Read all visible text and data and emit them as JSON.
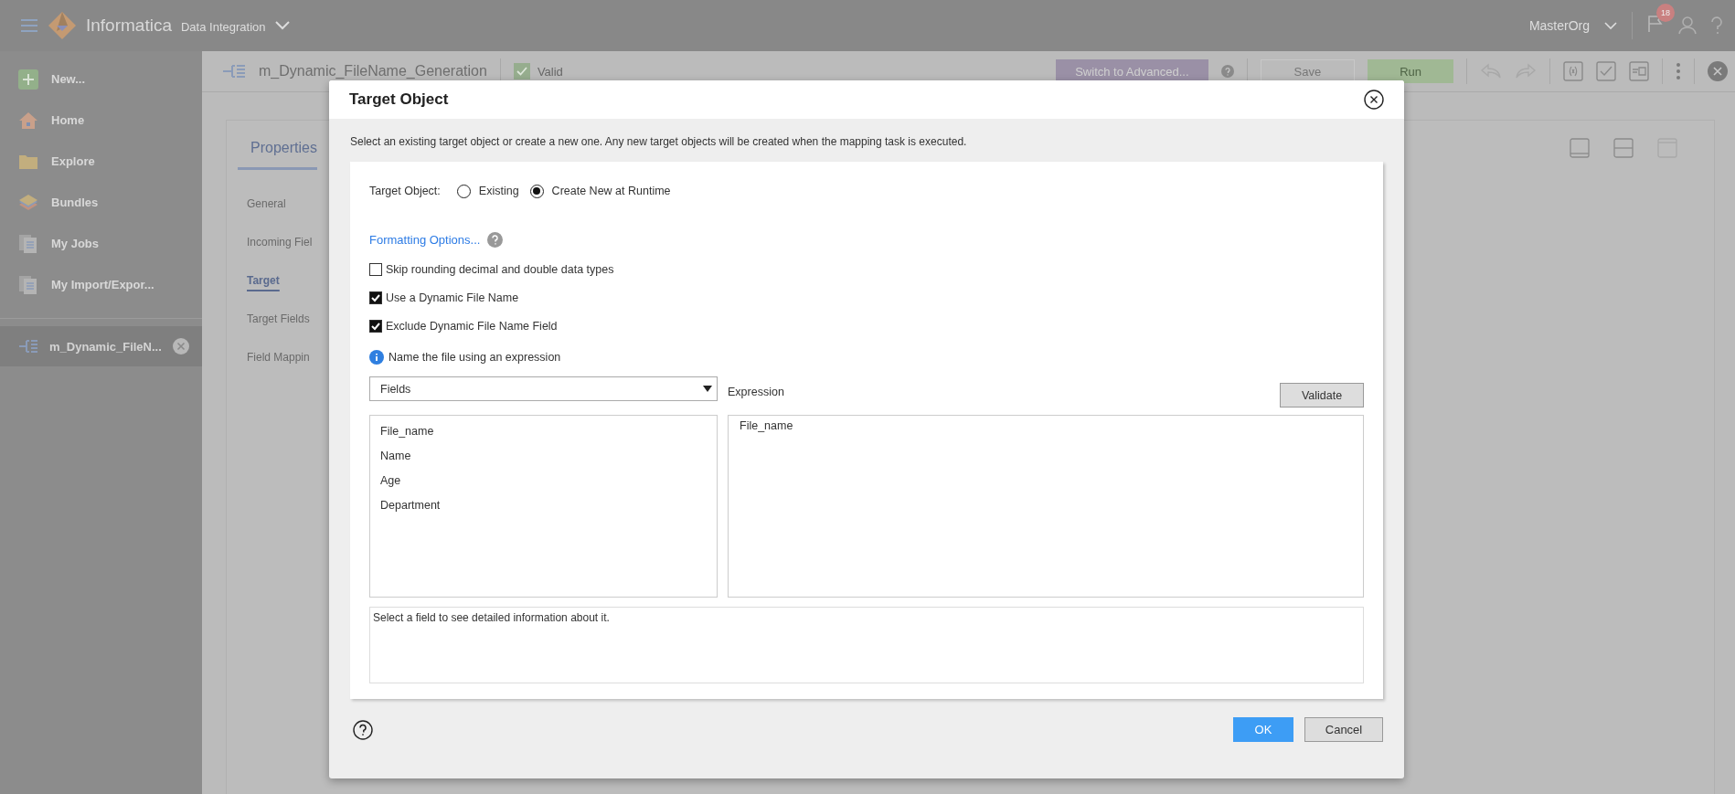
{
  "top_bar": {
    "product": "Informatica",
    "subtitle": "Data Integration",
    "org": "MasterOrg",
    "notification_count": "18"
  },
  "sidebar": {
    "items": [
      {
        "label": "New...",
        "kind": "new"
      },
      {
        "label": "Home",
        "kind": "home"
      },
      {
        "label": "Explore",
        "kind": "explore"
      },
      {
        "label": "Bundles",
        "kind": "bundles"
      },
      {
        "label": "My Jobs",
        "kind": "jobs"
      },
      {
        "label": "My Import/Expor...",
        "kind": "jobs"
      }
    ],
    "open_tabs": [
      {
        "label": "m_Dynamic_FileN...",
        "selected": true
      }
    ]
  },
  "toolbar": {
    "mapping_name": "m_Dynamic_FileName_Generation",
    "status": "Valid",
    "buttons": [
      {
        "label": "Switch to Advanced...",
        "kind": "advanced"
      },
      {
        "label": "Save",
        "kind": "save"
      },
      {
        "label": "Run",
        "kind": "run"
      }
    ]
  },
  "properties_panel": {
    "tab": "Properties",
    "nav": [
      {
        "label": "General",
        "selected": false
      },
      {
        "label": "Incoming Fiel",
        "selected": false
      },
      {
        "label": "Target",
        "selected": true
      },
      {
        "label": "Target Fields",
        "selected": false
      },
      {
        "label": "Field Mappin",
        "selected": false
      }
    ]
  },
  "dialog": {
    "title": "Target Object",
    "description": "Select an existing target object or create a new one. Any new target objects will be created when the mapping task is executed.",
    "target_object": {
      "label": "Target Object:",
      "options": [
        {
          "label": "Existing",
          "selected": false
        },
        {
          "label": "Create New at Runtime",
          "selected": true
        }
      ]
    },
    "formatting_link": "Formatting Options...",
    "checkboxes": [
      {
        "label": "Skip rounding decimal and double data types",
        "checked": false
      },
      {
        "label": "Use a Dynamic File Name",
        "checked": true
      },
      {
        "label": "Exclude Dynamic File Name Field",
        "checked": true
      }
    ],
    "info_note": "Name the file using an expression",
    "fields_dropdown": "Fields",
    "fields": [
      {
        "label": "File_name",
        "selected": false
      },
      {
        "label": "Name",
        "selected": false
      },
      {
        "label": "Age",
        "selected": false
      },
      {
        "label": "Department",
        "selected": false
      }
    ],
    "expression_label": "Expression",
    "validate_button": "Validate",
    "expression": "File_name",
    "field_info": "Select a field to see detailed information about it.",
    "buttons": [
      {
        "label": "OK",
        "kind": "primary"
      },
      {
        "label": "Cancel",
        "kind": "secondary"
      }
    ]
  }
}
